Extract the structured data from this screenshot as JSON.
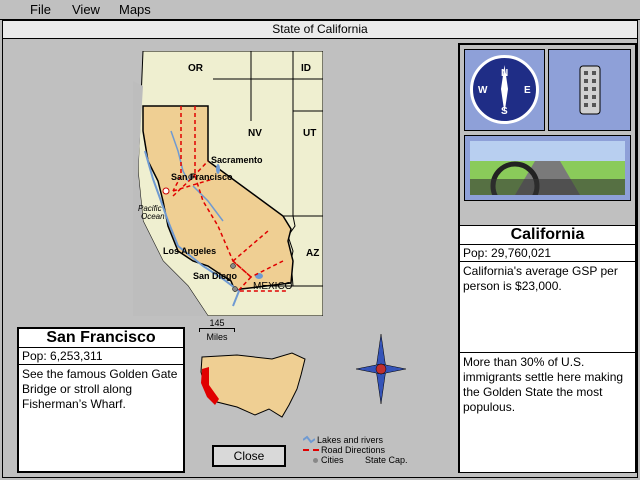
{
  "menu": {
    "items": [
      "File",
      "View",
      "Maps"
    ]
  },
  "window": {
    "title": "State of California"
  },
  "map": {
    "labels": {
      "or": "OR",
      "id": "ID",
      "nv": "NV",
      "ut": "UT",
      "az": "AZ",
      "mexico": "MEXICO",
      "pacific": "Pacific",
      "ocean": "Ocean",
      "sacramento": "Sacramento",
      "san_francisco": "San Francisco",
      "los_angeles": "Los Angeles",
      "san_diego": "San Diego"
    },
    "scale": {
      "value": "145",
      "unit": "Miles"
    },
    "colors": {
      "state": "#efcf93",
      "land": "#efefd0",
      "water": "#6f9ad2",
      "road": "#e00000"
    }
  },
  "city_panel": {
    "name": "San Francisco",
    "pop": "Pop: 6,253,311",
    "description": "See the famous Golden Gate Bridge or stroll along Fisherman’s Wharf."
  },
  "state_panel": {
    "name": "California",
    "pop": "Pop: 29,760,021",
    "fact1": "California's average GSP per person is $23,000.",
    "fact2": "More than 30% of U.S. immigrants settle here making the Golden State the most populous."
  },
  "compass": {
    "n": "N",
    "s": "S",
    "e": "E",
    "w": "W"
  },
  "legend": {
    "lakes": "Lakes and rivers",
    "roads": "Road Directions",
    "cities": "Cities",
    "capital": "State Cap."
  },
  "buttons": {
    "close": "Close"
  }
}
